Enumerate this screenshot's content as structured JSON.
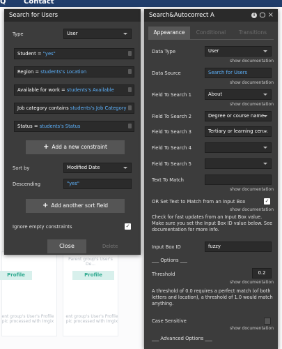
{
  "background": {
    "nav_items": [
      "Q",
      "Contact"
    ],
    "profile_label": "Profile",
    "faint_text_1": "Parent group's User's De...",
    "faint_text_2": "ent group's User's Profile pic processed with Imgix"
  },
  "search_panel": {
    "title": "Search for Users",
    "type_label": "Type",
    "type_value": "User",
    "constraints": [
      {
        "field": "Student =",
        "value": "\"yes\""
      },
      {
        "field": "Region =",
        "value": "students's Location"
      },
      {
        "field": "Available for work =",
        "value": "students's Available"
      },
      {
        "field": "Job category contains",
        "value": "students's Job Category"
      },
      {
        "field": "Status =",
        "value": "students's Status"
      }
    ],
    "add_constraint_label": "Add a new constraint",
    "sort_by_label": "Sort by",
    "sort_by_value": "Modified Date",
    "descending_label": "Descending",
    "descending_value": "\"yes\"",
    "add_sort_label": "Add another sort field",
    "ignore_empty_label": "Ignore empty constraints",
    "ignore_empty_checked": true,
    "close_label": "Close",
    "delete_label": "Delete"
  },
  "autocorrect_panel": {
    "title": "Search&Autocorrect A",
    "tabs": [
      "Appearance",
      "Conditional",
      "Transitions"
    ],
    "active_tab": 0,
    "show_documentation": "show documentation",
    "data_type_label": "Data Type",
    "data_type_value": "User",
    "data_source_label": "Data Source",
    "data_source_value": "Search for Users",
    "field1_label": "Field To Search 1",
    "field1_value": "About",
    "field2_label": "Field To Search 2",
    "field2_value": "Degree or course name",
    "field3_label": "Field To Search 3",
    "field3_value": "Tertiary or learning cen...",
    "field4_label": "Field To Search 4",
    "field5_label": "Field To Search 5",
    "text_to_match_label": "Text To Match",
    "or_set_text_label": "OR Set Text to Match from an Input Box",
    "or_set_text_checked": true,
    "input_box_note": "Check for fast updates from an Input Box value. Make sure you set the Input Box ID value below. See documentation for more info.",
    "input_box_id_label": "Input Box ID",
    "input_box_id_value": "fuzzy",
    "options_header": "___ Options ___",
    "threshold_label": "Threshold",
    "threshold_value": "0.2",
    "threshold_note": "A threshold of 0.0 requires a perfect match (of both letters and location), a threshold of 1.0 would match anything.",
    "case_sensitive_label": "Case Sensitive",
    "advanced_options_header": "___ Advanced Options ___"
  },
  "colors": {
    "panel_bg": "#3c3c3c",
    "header_bg": "#2a2a2a",
    "field_bg": "#2b2b2b",
    "dynamic_text": "#5eb4ff",
    "nav_bg": "#203d6b",
    "profile_green": "#2ea98f"
  },
  "icons": [
    "info-icon",
    "comment-icon",
    "close-icon",
    "caret-down-icon",
    "trash-icon",
    "plus-icon",
    "checkmark-icon"
  ]
}
